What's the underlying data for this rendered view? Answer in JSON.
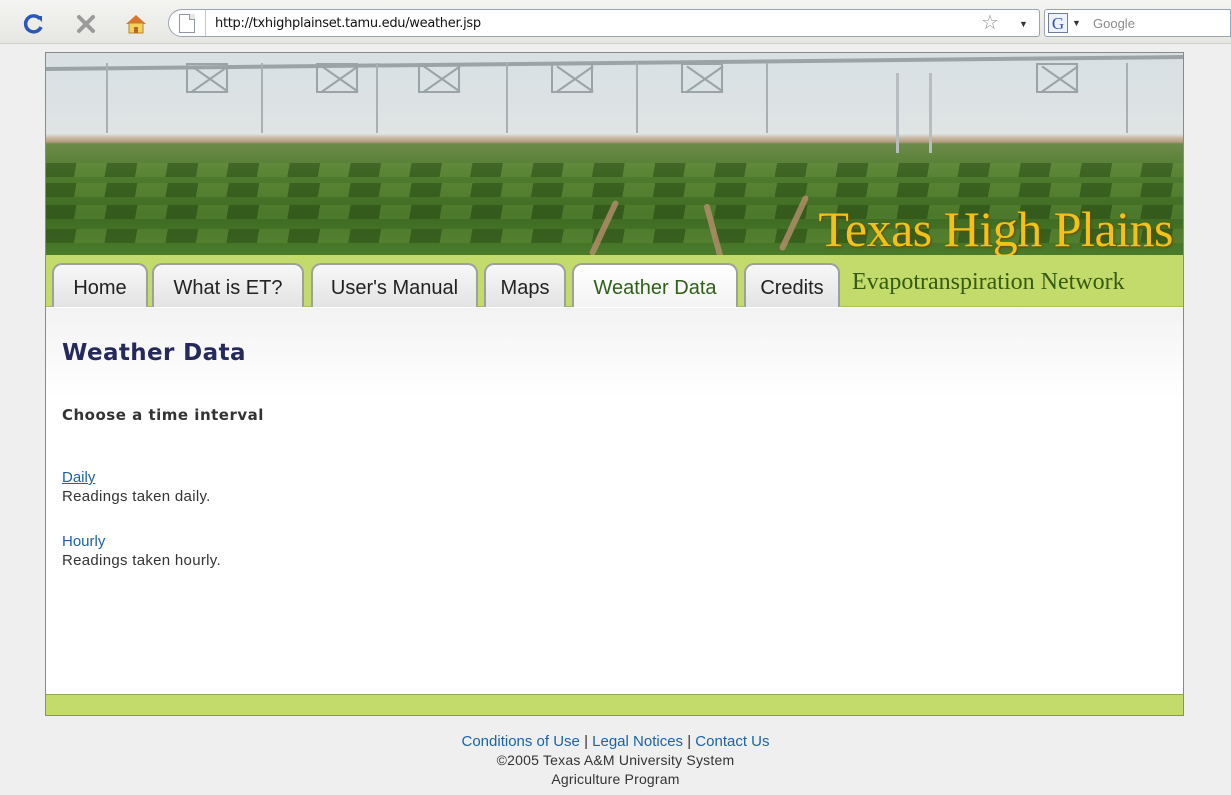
{
  "browser": {
    "url": "http://txhighplainset.tamu.edu/weather.jsp",
    "search_placeholder": "Google",
    "search_engine_icon": "G"
  },
  "banner": {
    "title": "Texas High Plains",
    "subtitle": "Evapotranspiration Network"
  },
  "nav": {
    "tabs": [
      {
        "label": "Home"
      },
      {
        "label": "What is ET?"
      },
      {
        "label": "User's Manual"
      },
      {
        "label": "Maps"
      },
      {
        "label": "Weather Data",
        "active": true
      },
      {
        "label": "Credits"
      }
    ]
  },
  "main": {
    "title": "Weather Data",
    "subtitle": "Choose a time interval",
    "options": [
      {
        "label": "Daily",
        "description": "Readings taken daily."
      },
      {
        "label": "Hourly",
        "description": "Readings taken hourly."
      }
    ]
  },
  "footer": {
    "links": [
      "Conditions of Use",
      "Legal Notices",
      "Contact Us"
    ],
    "separator": "|",
    "copyright": "©2005 Texas A&M University System",
    "program": "Agriculture Program"
  },
  "colors": {
    "nav_green": "#c2db6a",
    "title_navy": "#26295c",
    "link_blue": "#1b62a8",
    "banner_gold": "#f2c21b"
  }
}
